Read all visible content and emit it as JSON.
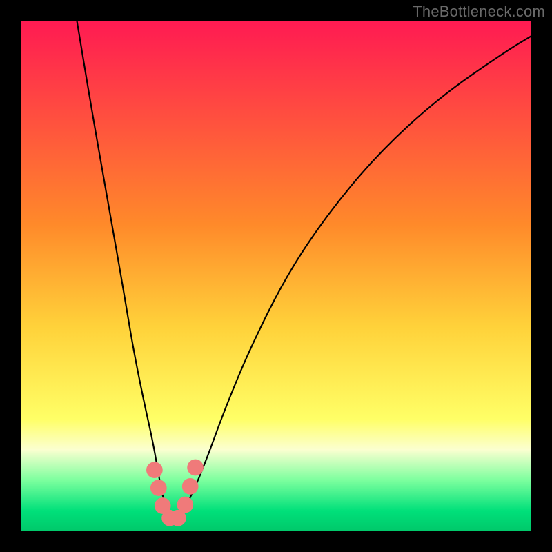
{
  "watermark": "TheBottleneck.com",
  "chart_data": {
    "type": "line",
    "title": "",
    "xlabel": "",
    "ylabel": "",
    "xlim": [
      0,
      100
    ],
    "ylim": [
      0,
      100
    ],
    "grid": false,
    "legend": false,
    "background_gradient": {
      "stops": [
        {
          "offset": 0.0,
          "color": "#ff1a52"
        },
        {
          "offset": 0.4,
          "color": "#ff8a2a"
        },
        {
          "offset": 0.6,
          "color": "#ffd23a"
        },
        {
          "offset": 0.78,
          "color": "#ffff66"
        },
        {
          "offset": 0.84,
          "color": "#fbffd0"
        },
        {
          "offset": 0.9,
          "color": "#7cff9e"
        },
        {
          "offset": 0.96,
          "color": "#00e07a"
        },
        {
          "offset": 1.0,
          "color": "#00c86a"
        }
      ]
    },
    "series": [
      {
        "name": "bottleneck-curve",
        "stroke": "#000000",
        "stroke_width": 2.2,
        "x": [
          11,
          14,
          17,
          20,
          22,
          24,
          26,
          27,
          28,
          29,
          30,
          31,
          33,
          36,
          40,
          45,
          52,
          60,
          70,
          82,
          95,
          100
        ],
        "y": [
          100,
          82,
          65,
          48,
          36,
          26,
          17,
          11,
          6,
          3,
          2,
          3,
          6,
          13,
          24,
          36,
          50,
          62,
          74,
          85,
          94,
          97
        ]
      }
    ],
    "markers": [
      {
        "name": "bead-left-1",
        "x": 26.2,
        "y": 12.0,
        "r": 1.6,
        "color": "#f07a7a"
      },
      {
        "name": "bead-left-2",
        "x": 27.0,
        "y": 8.5,
        "r": 1.6,
        "color": "#f07a7a"
      },
      {
        "name": "bead-left-3",
        "x": 27.8,
        "y": 5.0,
        "r": 1.6,
        "color": "#f07a7a"
      },
      {
        "name": "bead-bottom-1",
        "x": 29.2,
        "y": 2.6,
        "r": 1.6,
        "color": "#f07a7a"
      },
      {
        "name": "bead-bottom-2",
        "x": 30.8,
        "y": 2.6,
        "r": 1.6,
        "color": "#f07a7a"
      },
      {
        "name": "bead-right-1",
        "x": 32.2,
        "y": 5.2,
        "r": 1.6,
        "color": "#f07a7a"
      },
      {
        "name": "bead-right-2",
        "x": 33.2,
        "y": 8.8,
        "r": 1.6,
        "color": "#f07a7a"
      },
      {
        "name": "bead-right-3",
        "x": 34.2,
        "y": 12.5,
        "r": 1.6,
        "color": "#f07a7a"
      }
    ]
  }
}
